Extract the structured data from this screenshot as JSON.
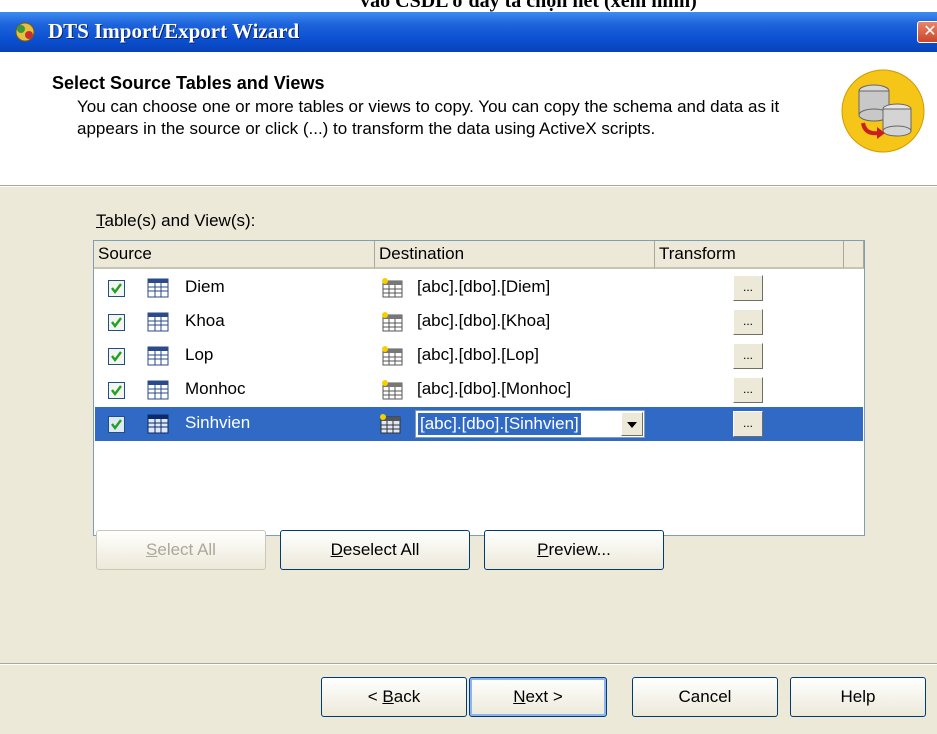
{
  "caption": "vào CSDL ở đây ta chọn hết (xem hình)",
  "window": {
    "title": "DTS Import/Export Wizard",
    "close_glyph": "✕"
  },
  "header": {
    "title": "Select Source Tables and Views",
    "description": "You can choose one or more tables or views to copy.  You can copy the schema and data as it appears in the source or click (...) to transform the data using ActiveX scripts.",
    "icon": "database-transfer-icon"
  },
  "list": {
    "label_accel": "T",
    "label_rest": "able(s) and View(s):",
    "columns": [
      "Source",
      "Destination",
      "Transform"
    ],
    "transform_label": "...",
    "rows": [
      {
        "source": "Diem",
        "destination": "[abc].[dbo].[Diem]",
        "checked": true,
        "selected": false
      },
      {
        "source": "Khoa",
        "destination": "[abc].[dbo].[Khoa]",
        "checked": true,
        "selected": false
      },
      {
        "source": "Lop",
        "destination": "[abc].[dbo].[Lop]",
        "checked": true,
        "selected": false
      },
      {
        "source": "Monhoc",
        "destination": "[abc].[dbo].[Monhoc]",
        "checked": true,
        "selected": false
      },
      {
        "source": "Sinhvien",
        "destination": "[abc].[dbo].[Sinhvien]",
        "checked": true,
        "selected": true
      }
    ]
  },
  "actions": {
    "select_all_accel": "S",
    "select_all_rest": "elect All",
    "deselect_all_accel": "D",
    "deselect_all_rest": "eselect All",
    "preview_accel": "P",
    "preview_rest": "review..."
  },
  "nav": {
    "back_prefix": "< ",
    "back_accel": "B",
    "back_rest": "ack",
    "next_accel": "N",
    "next_rest": "ext >",
    "cancel": "Cancel",
    "help": "Help"
  },
  "colors": {
    "selection": "#316ac5",
    "title_bar": "#0a4fd0",
    "dialog_bg": "#ece9d8"
  }
}
